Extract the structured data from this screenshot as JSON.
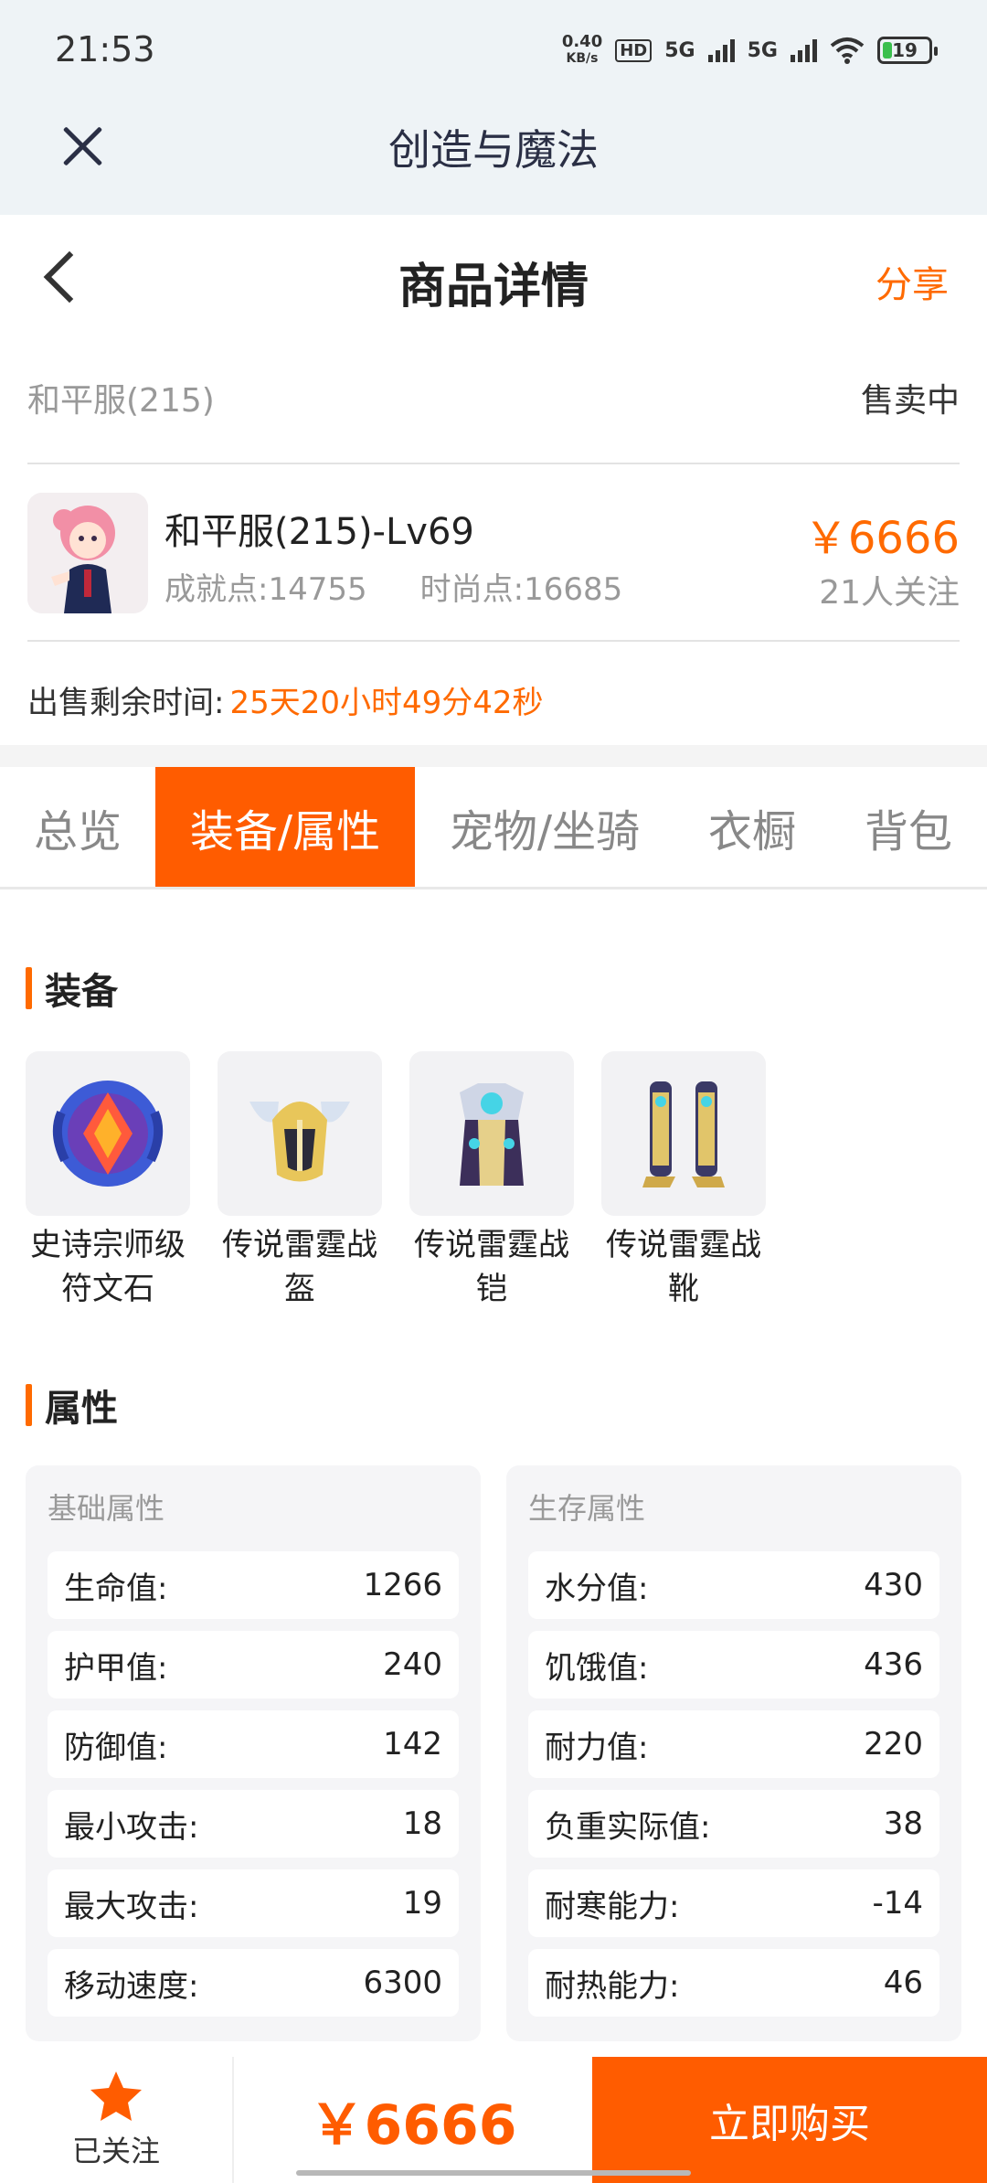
{
  "status_bar": {
    "time": "21:53",
    "net_speed_value": "0.40",
    "net_speed_unit": "KB/s",
    "hd_label": "HD",
    "signal1_label": "5G",
    "signal2_label": "5G",
    "battery": "19",
    "battery_level": 0.19
  },
  "app_bar": {
    "title": "创造与魔法"
  },
  "page_header": {
    "title": "商品详情",
    "share_label": "分享"
  },
  "listing": {
    "server": "和平服(215)",
    "status": "售卖中",
    "name": "和平服(215)-Lv69",
    "achievement": "成就点:14755",
    "fashion": "时尚点:16685",
    "price": "￥6666",
    "followers": "21人关注",
    "time_label": "出售剩余时间:",
    "time_value": "25天20小时49分42秒"
  },
  "tabs": [
    {
      "label": "总览"
    },
    {
      "label": "装备/属性"
    },
    {
      "label": "宠物/坐骑"
    },
    {
      "label": "衣橱"
    },
    {
      "label": "背包"
    }
  ],
  "equipment": {
    "title": "装备",
    "items": [
      {
        "name": "史诗宗师级符文石",
        "icon": "rune-stone-icon"
      },
      {
        "name": "传说雷霆战盔",
        "icon": "helmet-icon"
      },
      {
        "name": "传说雷霆战铠",
        "icon": "armor-icon"
      },
      {
        "name": "传说雷霆战靴",
        "icon": "boots-icon"
      }
    ]
  },
  "attributes": {
    "title": "属性",
    "basic": {
      "title": "基础属性",
      "rows": [
        {
          "label": "生命值:",
          "value": "1266"
        },
        {
          "label": "护甲值:",
          "value": "240"
        },
        {
          "label": "防御值:",
          "value": "142"
        },
        {
          "label": "最小攻击:",
          "value": "18"
        },
        {
          "label": "最大攻击:",
          "value": "19"
        },
        {
          "label": "移动速度:",
          "value": "6300"
        }
      ]
    },
    "survival": {
      "title": "生存属性",
      "rows": [
        {
          "label": "水分值:",
          "value": "430"
        },
        {
          "label": "饥饿值:",
          "value": "436"
        },
        {
          "label": "耐力值:",
          "value": "220"
        },
        {
          "label": "负重实际值:",
          "value": "38"
        },
        {
          "label": "耐寒能力:",
          "value": "-14"
        },
        {
          "label": "耐热能力:",
          "value": "46"
        }
      ]
    }
  },
  "bottom_bar": {
    "follow_label": "已关注",
    "price": "￥6666",
    "buy_label": "立即购买"
  },
  "colors": {
    "accent": "#ff5c00",
    "header_bg": "#eef3f6"
  }
}
